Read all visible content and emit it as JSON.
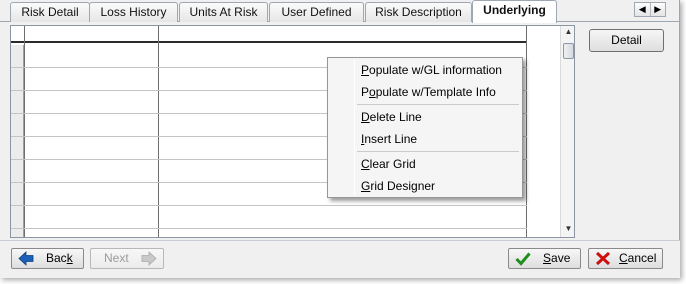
{
  "tabs": [
    {
      "label": "Risk Detail",
      "active": false
    },
    {
      "label": "Loss History",
      "active": false
    },
    {
      "label": "Units At Risk",
      "active": false
    },
    {
      "label": "User Defined",
      "active": false
    },
    {
      "label": "Risk Description",
      "active": false
    },
    {
      "label": "Underlying",
      "active": true
    }
  ],
  "tab_scroll": {
    "left_icon": "triangle-left-icon",
    "right_icon": "triangle-right-icon"
  },
  "context_menu": {
    "items": [
      {
        "label": "Populate w/GL information",
        "mnemonic": "P"
      },
      {
        "label": "Populate w/Template Info",
        "mnemonic": "o"
      },
      {
        "label": "Delete Line",
        "mnemonic": "D"
      },
      {
        "label": "Insert Line",
        "mnemonic": "I"
      },
      {
        "label": "Clear Grid",
        "mnemonic": "C"
      },
      {
        "label": "Grid Designer",
        "mnemonic": "G"
      }
    ]
  },
  "detail_button": {
    "label": "Detail"
  },
  "footer": {
    "back": {
      "label": "Back",
      "mnemonic": "k",
      "icon": "arrow-left-icon"
    },
    "next": {
      "label": "Next",
      "icon": "arrow-right-icon",
      "disabled": true
    },
    "save": {
      "label": "Save",
      "mnemonic": "S",
      "icon": "checkmark-icon"
    },
    "cancel": {
      "label": "Cancel",
      "mnemonic": "C",
      "icon": "x-icon"
    }
  },
  "colors": {
    "save_check": "#1e8f1e",
    "cancel_x": "#cc1010",
    "back_arrow": "#1b5fb8"
  }
}
